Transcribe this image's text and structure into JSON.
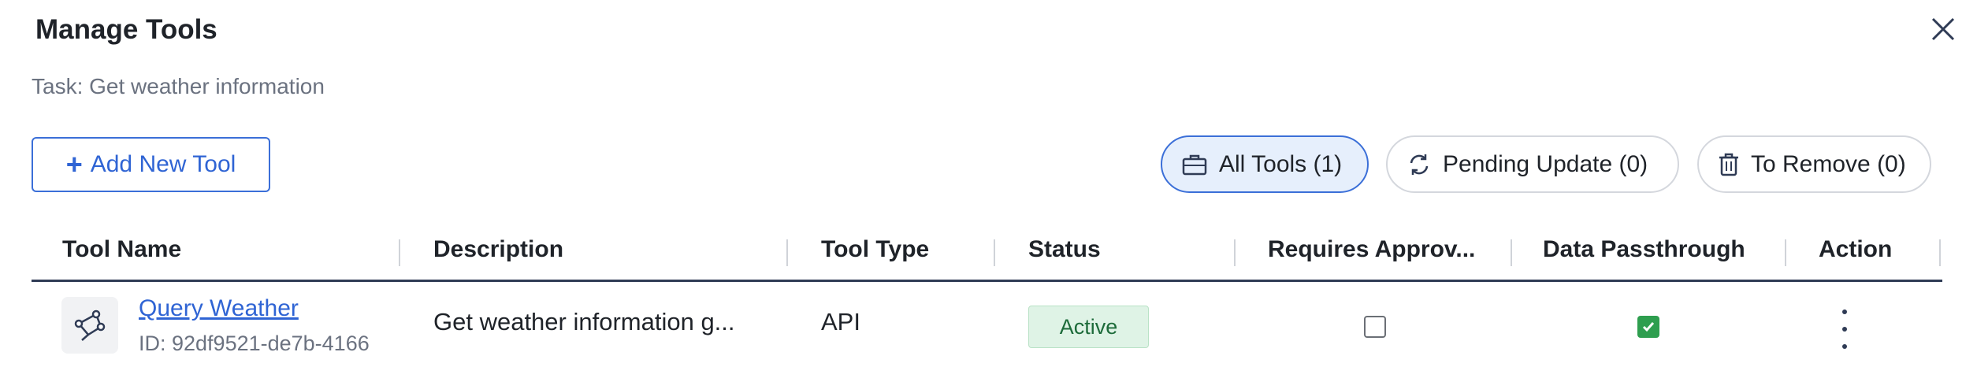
{
  "dialog": {
    "title": "Manage Tools",
    "subtitle": "Task: Get weather information",
    "close_icon": "close-icon"
  },
  "toolbar": {
    "add_label": "Add New Tool",
    "filters": [
      {
        "label": "All Tools (1)",
        "icon": "briefcase-icon",
        "active": true
      },
      {
        "label": "Pending Update (0)",
        "icon": "refresh-icon",
        "active": false
      },
      {
        "label": "To Remove (0)",
        "icon": "trash-icon",
        "active": false
      }
    ]
  },
  "table": {
    "columns": [
      "Tool Name",
      "Description",
      "Tool Type",
      "Status",
      "Requires Approv...",
      "Data Passthrough",
      "Action"
    ],
    "rows": [
      {
        "icon": "tool-node-icon",
        "name": "Query Weather",
        "id": "ID: 92df9521-de7b-4166",
        "description": "Get weather information g...",
        "type": "API",
        "status": "Active",
        "requires_approval": false,
        "data_passthrough": true
      }
    ]
  },
  "colors": {
    "accent": "#2f64d4",
    "active_badge_bg": "#dff3e6",
    "checkbox_on": "#2e9e4f"
  }
}
